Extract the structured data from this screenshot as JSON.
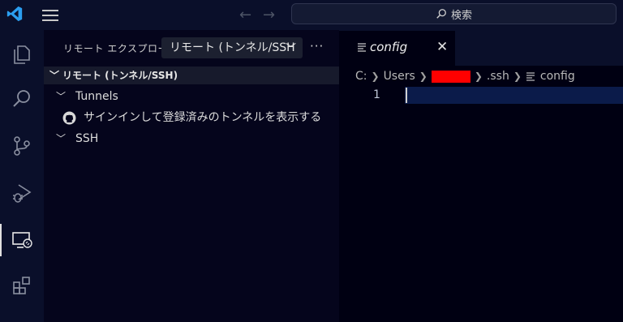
{
  "titlebar": {
    "search_label": "検索",
    "icons": [
      "vscode-logo",
      "menu-icon",
      "back-arrow-icon",
      "forward-arrow-icon",
      "search-icon"
    ]
  },
  "activity_bar": {
    "items": [
      "explorer-icon",
      "search-icon",
      "source-control-icon",
      "run-debug-icon",
      "remote-explorer-icon",
      "extensions-icon"
    ],
    "active": "remote-explorer-icon"
  },
  "sidebar": {
    "title": "リモート エクスプローラー",
    "selector_value": "リモート (トンネル/SSH",
    "more_label": "···",
    "section_title": "リモート (トンネル/SSH)",
    "tree": {
      "tunnels_label": "Tunnels",
      "signin_label": "サインインして登録済みのトンネルを表示する",
      "ssh_label": "SSH"
    }
  },
  "editor": {
    "tab_name": "config",
    "close_label": "✕",
    "breadcrumb": {
      "drive": "C:",
      "folder1": "Users",
      "folder2": ".ssh",
      "file": "config"
    },
    "line_number": "1"
  },
  "colors": {
    "background": "#000012",
    "chrome": "#0a0f2a",
    "accent": "#0078d4",
    "redaction": "#ff0000",
    "current_line": "#0b1b4a"
  }
}
